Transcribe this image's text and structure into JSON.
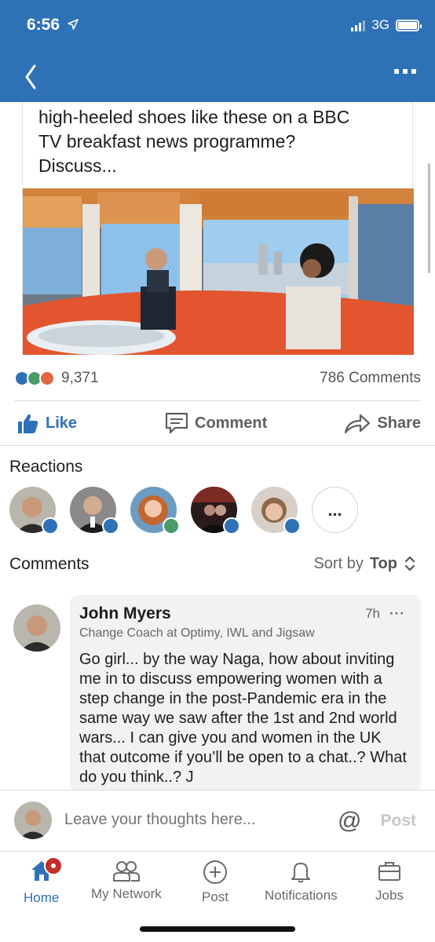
{
  "status_bar": {
    "time": "6:56",
    "network": "3G"
  },
  "post": {
    "text_lines": [
      "high-heeled shoes like these on a BBC",
      "TV breakfast news programme?",
      "Discuss..."
    ],
    "reactions_count": "9,371",
    "comments_count": "786 Comments"
  },
  "actions": {
    "like": "Like",
    "comment": "Comment",
    "share": "Share"
  },
  "reactions": {
    "title": "Reactions",
    "more": "..."
  },
  "comments": {
    "title": "Comments",
    "sort_prefix": "Sort by",
    "sort_value": "Top",
    "items": [
      {
        "author": "John Myers",
        "headline": "Change Coach at Optimy, IWL and Jigsaw",
        "time": "7h",
        "more": "···",
        "text": "Go girl... by the way Naga, how about inviting me in to discuss empowering women with a step change in the post-Pandemic era in the same way we saw after the 1st and 2nd world wars... I can give you and women in the UK that outcome if you’ll be open to a chat..? What do you think..? J"
      }
    ]
  },
  "composer": {
    "placeholder": "Leave your thoughts here...",
    "at_symbol": "@",
    "post": "Post"
  },
  "tabs": [
    {
      "label": "Home",
      "icon": "home-icon"
    },
    {
      "label": "My Network",
      "icon": "network-icon"
    },
    {
      "label": "Post",
      "icon": "post-plus-icon"
    },
    {
      "label": "Notifications",
      "icon": "bell-icon"
    },
    {
      "label": "Jobs",
      "icon": "briefcase-icon"
    }
  ],
  "colors": {
    "brand": "#2f71b6",
    "badge": "#c22f2a",
    "background": "#ffffff"
  }
}
